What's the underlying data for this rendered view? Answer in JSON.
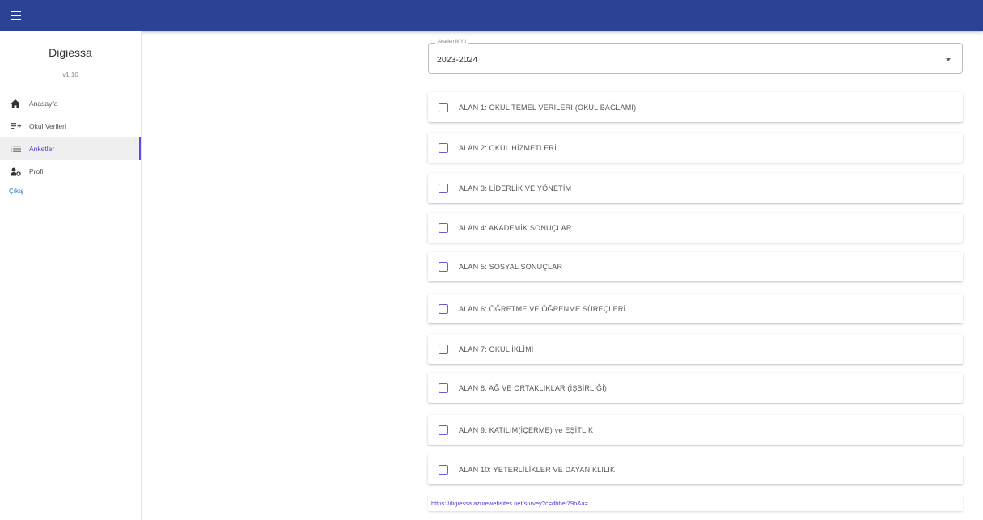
{
  "sidebar": {
    "brand": "Digiessa",
    "version": "v1.10",
    "items": [
      {
        "label": "Anasayfa",
        "icon": "home-icon"
      },
      {
        "label": "Okul Verileri",
        "icon": "playlist-add-icon"
      },
      {
        "label": "Anketler",
        "icon": "list-icon"
      },
      {
        "label": "Profil",
        "icon": "person-gear-icon"
      }
    ],
    "logout": "Çıkış"
  },
  "year_select": {
    "label": "Akademik Yıl",
    "value": "2023-2024"
  },
  "areas": [
    {
      "label": "ALAN 1: OKUL TEMEL VERİLERİ (OKUL BAĞLAMI)"
    },
    {
      "label": "ALAN 2: OKUL HİZMETLERİ"
    },
    {
      "label": "ALAN 3: LİDERLİK VE YÖNETİM"
    },
    {
      "label": "ALAN 4: AKADEMİK SONUÇLAR"
    },
    {
      "label": "ALAN 5: SOSYAL SONUÇLAR"
    },
    {
      "label": "ALAN 6: ÖĞRETME VE ÖĞRENME SÜREÇLERİ"
    },
    {
      "label": "ALAN 7: OKUL İKLİMİ"
    },
    {
      "label": "ALAN 8: AĞ VE ORTAKLIKLAR (İŞBİRLİĞİ)"
    },
    {
      "label": "ALAN 9: KATILIM(İÇERME) ve EŞİTLİK"
    },
    {
      "label": "ALAN 10: YETERLİLİKLER VE DAYANIKLILIK"
    }
  ],
  "survey_link": "https://digiessa.azurewebsites.net/survey?c=dbbef79b&a=",
  "colors": {
    "appbar": "#2b4296",
    "accent": "#5b4be0"
  }
}
